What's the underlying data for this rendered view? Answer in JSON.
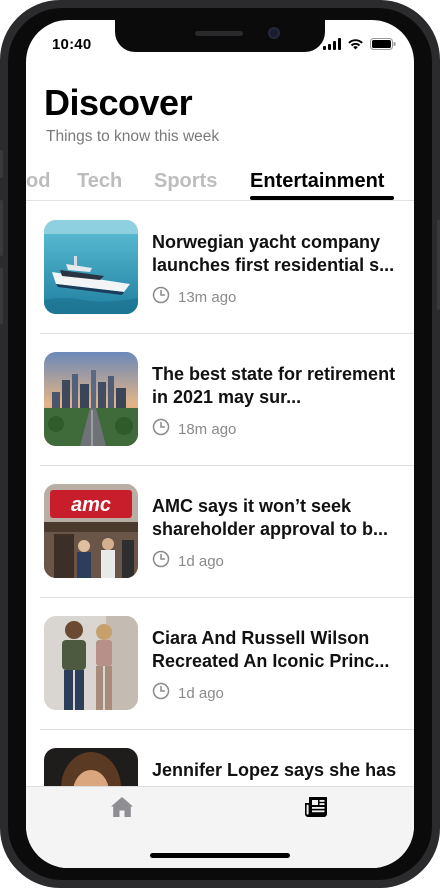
{
  "status_bar": {
    "time": "10:40",
    "icons": [
      "cellular-signal-icon",
      "wifi-icon",
      "battery-icon"
    ]
  },
  "header": {
    "title": "Discover",
    "subtitle": "Things to know this week"
  },
  "tabs": [
    {
      "label": "od",
      "active": false
    },
    {
      "label": "Tech",
      "active": false
    },
    {
      "label": "Sports",
      "active": false
    },
    {
      "label": "Entertainment",
      "active": true
    }
  ],
  "articles": [
    {
      "headline": "Norwegian yacht company launches first residential s...",
      "time": "13m ago",
      "thumbnail": "yacht-photo"
    },
    {
      "headline": "The best state for retirement in 2021 may sur...",
      "time": "18m ago",
      "thumbnail": "city-skyline-photo"
    },
    {
      "headline": "AMC says it won’t seek shareholder approval to b...",
      "time": "1d ago",
      "thumbnail": "amc-theater-photo"
    },
    {
      "headline": "Ciara And Russell Wilson Recreated An Iconic Princ...",
      "time": "1d ago",
      "thumbnail": "couple-photo"
    },
    {
      "headline": "Jennifer Lopez says she has",
      "time": "",
      "thumbnail": "portrait-photo"
    }
  ],
  "tab_bar": {
    "items": [
      {
        "icon": "home-icon",
        "active": false
      },
      {
        "icon": "newspaper-icon",
        "active": true
      }
    ]
  },
  "colors": {
    "accent": "#000000",
    "inactive_tab": "#bdbdbd",
    "subtitle": "#7a7a7a",
    "meta": "#8a8a8a"
  }
}
